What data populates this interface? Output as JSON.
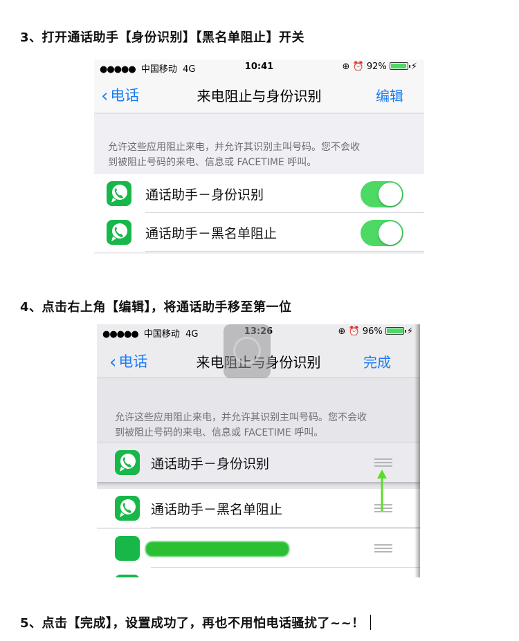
{
  "steps": {
    "step3": "3、打开通话助手【身份识别】【黑名单阻止】开关",
    "step4": "4、点击右上角【编辑】，将通话助手移至第一位",
    "step5": "5、点击【完成】，设置成功了，再也不用怕电话骚扰了~~！"
  },
  "screenshot1": {
    "status": {
      "signal": "●●●●●",
      "carrier": "中国移动",
      "network": "4G",
      "time": "10:41",
      "battery": "92%",
      "battery_level": 0.92
    },
    "nav": {
      "back": "电话",
      "title": "来电阻止与身份识别",
      "action": "编辑"
    },
    "description_line1": "允许这些应用阻止来电，并允许其识别主叫号码。您不会收",
    "description_line2": "到被阻止号码的来电、信息或 FACETIME 呼叫。",
    "items": [
      {
        "label": "通话助手－身份识别",
        "enabled": true
      },
      {
        "label": "通话助手－黑名单阻止",
        "enabled": true
      }
    ]
  },
  "screenshot2": {
    "status": {
      "signal": "●●●●●",
      "carrier": "中国移动",
      "network": "4G",
      "time": "13:26",
      "battery": "96%",
      "battery_level": 0.96
    },
    "nav": {
      "back": "电话",
      "title": "来电阻止与身份识别",
      "action": "完成"
    },
    "description_line1": "允许这些应用阻止来电，并允许其识别主叫号码。您不会收",
    "description_line2": "到被阻止号码的来电、信息或 FACETIME 呼叫。",
    "items": [
      {
        "label": "通话助手－身份识别"
      },
      {
        "label": "通话助手－黑名单阻止"
      }
    ]
  },
  "colors": {
    "ios_blue": "#1a7cf5",
    "switch_green": "#4cd964",
    "app_green": "#18b74a",
    "arrow_green": "#5bdc2a"
  },
  "icons": {
    "back": "chevron-left-icon",
    "app": "phone-bubble-icon",
    "reorder": "reorder-grip-icon",
    "alarm": "alarm-icon",
    "lock": "rotation-lock-icon"
  }
}
